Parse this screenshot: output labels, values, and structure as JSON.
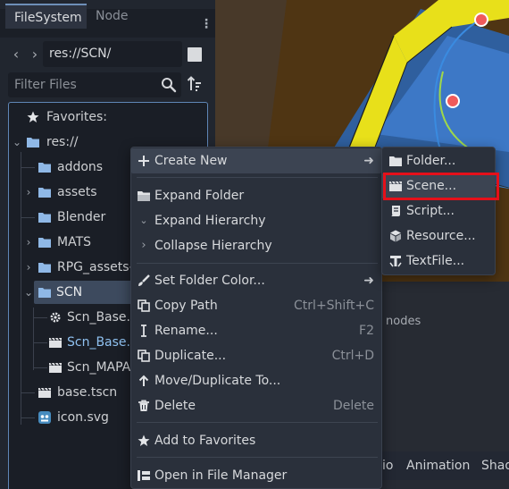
{
  "dock": {
    "tabs": [
      "FileSystem",
      "Node"
    ],
    "path": "res://SCN/",
    "filter_placeholder": "Filter Files"
  },
  "tree": {
    "favorites": "Favorites:",
    "root": "res://",
    "items": [
      "addons",
      "assets",
      "Blender",
      "MATS",
      "RPG_assets-n",
      "SCN"
    ],
    "scn_children": [
      "Scn_Base.g",
      "Scn_Base.t",
      "Scn_MAPA."
    ],
    "root_files": [
      "base.tscn",
      "icon.svg"
    ]
  },
  "context_menu": {
    "items": [
      {
        "label": "Create New",
        "shortcut": ""
      },
      {
        "label": "Expand Folder",
        "shortcut": ""
      },
      {
        "label": "Expand Hierarchy",
        "shortcut": ""
      },
      {
        "label": "Collapse Hierarchy",
        "shortcut": ""
      },
      {
        "label": "Set Folder Color...",
        "shortcut": ""
      },
      {
        "label": "Copy Path",
        "shortcut": "Ctrl+Shift+C"
      },
      {
        "label": "Rename...",
        "shortcut": "F2"
      },
      {
        "label": "Duplicate...",
        "shortcut": "Ctrl+D"
      },
      {
        "label": "Move/Duplicate To...",
        "shortcut": ""
      },
      {
        "label": "Delete",
        "shortcut": "Delete"
      },
      {
        "label": "Add to Favorites",
        "shortcut": ""
      },
      {
        "label": "Open in File Manager",
        "shortcut": ""
      }
    ]
  },
  "submenu": {
    "items": [
      "Folder...",
      "Scene...",
      "Script...",
      "Resource...",
      "TextFile..."
    ]
  },
  "viewport": {
    "nodes_label": "nodes",
    "bottom_tabs": [
      "io",
      "Animation",
      "Shad"
    ]
  },
  "colors": {
    "accent": "#6e8fb8",
    "folder": "#8fb8e6",
    "highlight_box": "#e5101a",
    "selected_file_text": "#8fc1f0"
  }
}
